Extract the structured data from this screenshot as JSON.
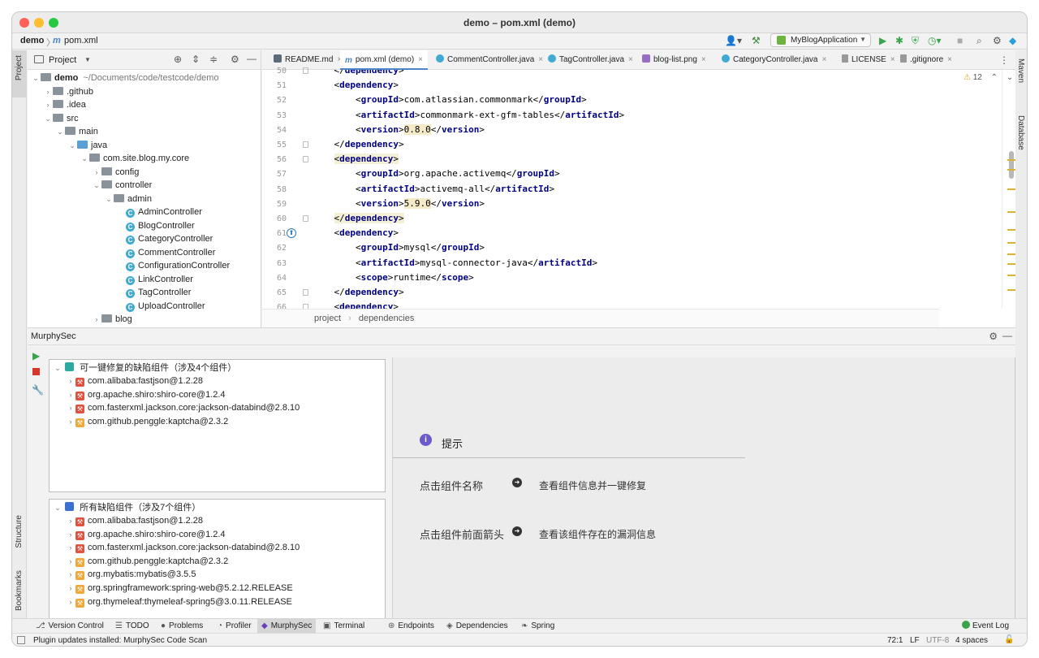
{
  "window": {
    "title": "demo – pom.xml (demo)"
  },
  "nav": {
    "project": "demo",
    "sep": "〉",
    "file": "pom.xml",
    "run_config": "MyBlogApplication"
  },
  "left_strip": {
    "project": "Project",
    "structure": "Structure",
    "bookmarks": "Bookmarks"
  },
  "right_strip": {
    "maven": "Maven",
    "database": "Database"
  },
  "project_panel": {
    "title": "Project",
    "tree": [
      {
        "label": "demo",
        "suffix": "~/Documents/code/testcode/demo",
        "arrow": "⌄",
        "kind": "folder"
      },
      {
        "label": ".github",
        "arrow": "›",
        "kind": "folder"
      },
      {
        "label": ".idea",
        "arrow": "›",
        "kind": "folder"
      },
      {
        "label": "src",
        "arrow": "⌄",
        "kind": "folder"
      },
      {
        "label": "main",
        "arrow": "⌄",
        "kind": "folder"
      },
      {
        "label": "java",
        "arrow": "⌄",
        "kind": "folder-blue"
      },
      {
        "label": "com.site.blog.my.core",
        "arrow": "⌄",
        "kind": "folder"
      },
      {
        "label": "config",
        "arrow": "›",
        "kind": "folder"
      },
      {
        "label": "controller",
        "arrow": "⌄",
        "kind": "folder"
      },
      {
        "label": "admin",
        "arrow": "⌄",
        "kind": "folder"
      },
      {
        "label": "AdminController",
        "arrow": "",
        "kind": "class"
      },
      {
        "label": "BlogController",
        "arrow": "",
        "kind": "class"
      },
      {
        "label": "CategoryController",
        "arrow": "",
        "kind": "class"
      },
      {
        "label": "CommentController",
        "arrow": "",
        "kind": "class"
      },
      {
        "label": "ConfigurationController",
        "arrow": "",
        "kind": "class"
      },
      {
        "label": "LinkController",
        "arrow": "",
        "kind": "class"
      },
      {
        "label": "TagController",
        "arrow": "",
        "kind": "class"
      },
      {
        "label": "UploadController",
        "arrow": "",
        "kind": "class"
      },
      {
        "label": "blog",
        "arrow": "›",
        "kind": "folder"
      }
    ]
  },
  "editor": {
    "tabs": [
      {
        "label": "README.md",
        "active": false
      },
      {
        "label": "pom.xml (demo)",
        "active": true
      },
      {
        "label": "CommentController.java",
        "active": false
      },
      {
        "label": "TagController.java",
        "active": false
      },
      {
        "label": "blog-list.png",
        "active": false
      },
      {
        "label": "CategoryController.java",
        "active": false
      },
      {
        "label": "LICENSE",
        "active": false
      },
      {
        "label": ".gitignore",
        "active": false
      }
    ],
    "warnings": "12",
    "lines": [
      {
        "n": "50",
        "indent": "    ",
        "pre": "</",
        "tag": "dependency",
        "post": ">",
        "text": "",
        "close": ""
      },
      {
        "n": "51",
        "indent": "    ",
        "pre": "<",
        "tag": "dependency",
        "post": ">",
        "text": "",
        "close": ""
      },
      {
        "n": "52",
        "indent": "        ",
        "pre": "<",
        "tag": "groupId",
        "post": ">",
        "text": "com.atlassian.commonmark",
        "close": "groupId"
      },
      {
        "n": "53",
        "indent": "        ",
        "pre": "<",
        "tag": "artifactId",
        "post": ">",
        "text": "commonmark-ext-gfm-tables",
        "close": "artifactId"
      },
      {
        "n": "54",
        "indent": "        ",
        "pre": "<",
        "tag": "version",
        "post": ">",
        "text": "0.8.0",
        "close": "version",
        "hl": true
      },
      {
        "n": "55",
        "indent": "    ",
        "pre": "</",
        "tag": "dependency",
        "post": ">",
        "text": "",
        "close": ""
      },
      {
        "n": "56",
        "indent": "    ",
        "pre": "<",
        "tag": "dependency",
        "post": ">",
        "text": "",
        "close": "",
        "bg": true
      },
      {
        "n": "57",
        "indent": "        ",
        "pre": "<",
        "tag": "groupId",
        "post": ">",
        "text": "org.apache.activemq",
        "close": "groupId"
      },
      {
        "n": "58",
        "indent": "        ",
        "pre": "<",
        "tag": "artifactId",
        "post": ">",
        "text": "activemq-all",
        "close": "artifactId"
      },
      {
        "n": "59",
        "indent": "        ",
        "pre": "<",
        "tag": "version",
        "post": ">",
        "text": "5.9.0",
        "close": "version",
        "hl": true
      },
      {
        "n": "60",
        "indent": "    ",
        "pre": "</",
        "tag": "dependency",
        "post": ">",
        "text": "",
        "close": "",
        "bg": true
      },
      {
        "n": "61",
        "indent": "    ",
        "pre": "<",
        "tag": "dependency",
        "post": ">",
        "text": "",
        "close": ""
      },
      {
        "n": "62",
        "indent": "        ",
        "pre": "<",
        "tag": "groupId",
        "post": ">",
        "text": "mysql",
        "close": "groupId"
      },
      {
        "n": "63",
        "indent": "        ",
        "pre": "<",
        "tag": "artifactId",
        "post": ">",
        "text": "mysql-connector-java",
        "close": "artifactId"
      },
      {
        "n": "64",
        "indent": "        ",
        "pre": "<",
        "tag": "scope",
        "post": ">",
        "text": "runtime",
        "close": "scope"
      },
      {
        "n": "65",
        "indent": "    ",
        "pre": "</",
        "tag": "dependency",
        "post": ">",
        "text": "",
        "close": ""
      },
      {
        "n": "66",
        "indent": "    ",
        "pre": "<",
        "tag": "dependency",
        "post": ">",
        "text": "",
        "close": ""
      }
    ],
    "breadcrumb": [
      "project",
      "dependencies"
    ]
  },
  "murphy": {
    "title": "MurphySec",
    "fixable": {
      "header": "可一键修复的缺陷组件（涉及4个组件）",
      "items": [
        {
          "label": "com.alibaba:fastjson@1.2.28",
          "level": "red"
        },
        {
          "label": "org.apache.shiro:shiro-core@1.2.4",
          "level": "red"
        },
        {
          "label": "com.fasterxml.jackson.core:jackson-databind@2.8.10",
          "level": "red"
        },
        {
          "label": "com.github.penggle:kaptcha@2.3.2",
          "level": "org"
        }
      ]
    },
    "all": {
      "header": "所有缺陷组件（涉及7个组件）",
      "items": [
        {
          "label": "com.alibaba:fastjson@1.2.28",
          "level": "red"
        },
        {
          "label": "org.apache.shiro:shiro-core@1.2.4",
          "level": "red"
        },
        {
          "label": "com.fasterxml.jackson.core:jackson-databind@2.8.10",
          "level": "red"
        },
        {
          "label": "com.github.penggle:kaptcha@2.3.2",
          "level": "org"
        },
        {
          "label": "org.mybatis:mybatis@3.5.5",
          "level": "org"
        },
        {
          "label": "org.springframework:spring-web@5.2.12.RELEASE",
          "level": "org"
        },
        {
          "label": "org.thymeleaf:thymeleaf-spring5@3.0.11.RELEASE",
          "level": "org"
        }
      ]
    },
    "tips": {
      "title": "提示",
      "row1_label": "点击组件名称",
      "row1_desc": "查看组件信息并一键修复",
      "row2_label": "点击组件前面箭头",
      "row2_desc": "查看该组件存在的漏洞信息"
    }
  },
  "tool_tabs": [
    {
      "label": "Version Control",
      "icon": "⎇",
      "active": false
    },
    {
      "label": "TODO",
      "icon": "☰",
      "active": false
    },
    {
      "label": "Problems",
      "icon": "●",
      "active": false
    },
    {
      "label": "Profiler",
      "icon": "◔",
      "active": false
    },
    {
      "label": "MurphySec",
      "icon": "◆",
      "active": true
    },
    {
      "label": "Terminal",
      "icon": "▣",
      "active": false
    },
    {
      "label": "Endpoints",
      "icon": "⊛",
      "active": false
    },
    {
      "label": "Dependencies",
      "icon": "◈",
      "active": false
    },
    {
      "label": "Spring",
      "icon": "❧",
      "active": false
    }
  ],
  "event_log": "Event Log",
  "status": {
    "message": "Plugin updates installed: MurphySec Code Scan",
    "position": "72:1",
    "line_sep": "LF",
    "encoding": "UTF-8",
    "indent": "4 spaces"
  },
  "colors": {
    "accent": "#4a86c8",
    "vuln_high": "#e05240",
    "vuln_mid": "#f0a83a",
    "xml_tag": "#000080",
    "run_green": "#3aa34b"
  }
}
